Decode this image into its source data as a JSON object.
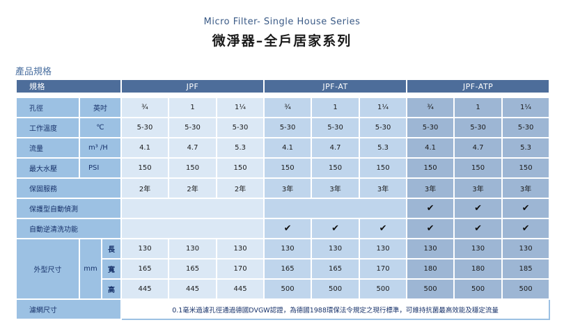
{
  "header": {
    "subtitle": "Micro Filter- Single House Series",
    "title": "微淨器–全戶居家系列"
  },
  "section_label": "產品規格",
  "table": {
    "spec_col": "規格",
    "groups": [
      "JPF",
      "JPF-AT",
      "JPF-ATP"
    ],
    "rows": {
      "pore": {
        "label": "孔徑",
        "unit": "英吋",
        "values": [
          "¾",
          "1",
          "1¼",
          "¾",
          "1",
          "1¼",
          "¾",
          "1",
          "1¼"
        ]
      },
      "temp": {
        "label": "工作溫度",
        "unit": "℃",
        "values": [
          "5-30",
          "5-30",
          "5-30",
          "5-30",
          "5-30",
          "5-30",
          "5-30",
          "5-30",
          "5-30"
        ]
      },
      "flow": {
        "label": "流量",
        "unit": "m³ /H",
        "values": [
          "4.1",
          "4.7",
          "5.3",
          "4.1",
          "4.7",
          "5.3",
          "4.1",
          "4.7",
          "5.3"
        ]
      },
      "pressure": {
        "label": "最大水壓",
        "unit": "PSI",
        "values": [
          "150",
          "150",
          "150",
          "150",
          "150",
          "150",
          "150",
          "150",
          "150"
        ]
      },
      "warranty": {
        "label": "保固服務",
        "values": [
          "2年",
          "2年",
          "2年",
          "3年",
          "3年",
          "3年",
          "3年",
          "3年",
          "3年"
        ]
      },
      "auto_detect": {
        "label": "保護型自動偵測",
        "values": [
          "",
          "",
          "",
          "",
          "",
          "",
          "✔",
          "✔",
          "✔"
        ]
      },
      "auto_backwash": {
        "label": "自動逆清洗功能",
        "values": [
          "",
          "",
          "",
          "✔",
          "✔",
          "✔",
          "✔",
          "✔",
          "✔"
        ]
      },
      "dimensions": {
        "label": "外型尺寸",
        "unit": "mm",
        "length": {
          "label": "長",
          "values": [
            "130",
            "130",
            "130",
            "130",
            "130",
            "130",
            "130",
            "130",
            "130"
          ]
        },
        "width": {
          "label": "寬",
          "values": [
            "165",
            "165",
            "170",
            "165",
            "165",
            "170",
            "180",
            "180",
            "185"
          ]
        },
        "height": {
          "label": "高",
          "values": [
            "445",
            "445",
            "445",
            "500",
            "500",
            "500",
            "500",
            "500",
            "500"
          ]
        }
      },
      "mesh": {
        "label": "濾網尺寸",
        "note": "0.1毫米過濾孔徑通過德國DVGW認證，為德國1988環保法令規定之現行標準，可維持抗菌最高效能及穩定流量"
      }
    }
  }
}
